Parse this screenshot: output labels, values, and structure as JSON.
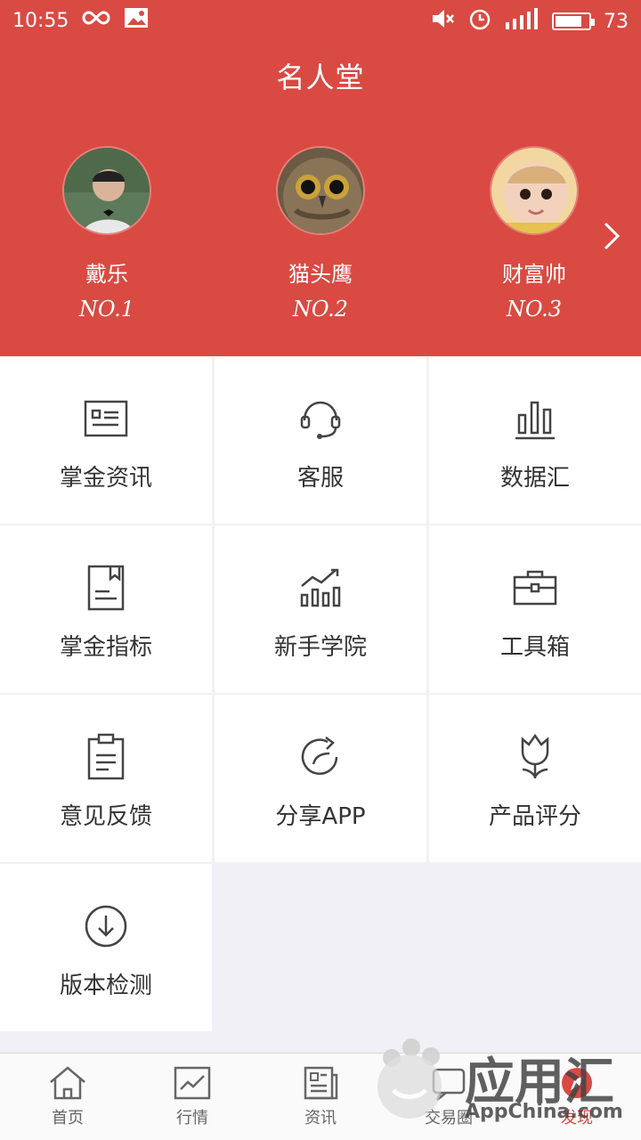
{
  "status_bar": {
    "time": "10:55",
    "network": "4G",
    "battery": "73"
  },
  "header": {
    "title": "名人堂"
  },
  "hall_of_fame": [
    {
      "name": "戴乐",
      "rank": "NO.1"
    },
    {
      "name": "猫头鹰",
      "rank": "NO.2"
    },
    {
      "name": "财富帅",
      "rank": "NO.3"
    }
  ],
  "menu": [
    {
      "label": "掌金资讯",
      "icon": "news-icon"
    },
    {
      "label": "客服",
      "icon": "headset-icon"
    },
    {
      "label": "数据汇",
      "icon": "bar-chart-icon"
    },
    {
      "label": "掌金指标",
      "icon": "document-icon"
    },
    {
      "label": "新手学院",
      "icon": "growth-chart-icon"
    },
    {
      "label": "工具箱",
      "icon": "toolbox-icon"
    },
    {
      "label": "意见反馈",
      "icon": "clipboard-icon"
    },
    {
      "label": "分享APP",
      "icon": "share-refresh-icon"
    },
    {
      "label": "产品评分",
      "icon": "tulip-icon"
    },
    {
      "label": "版本检测",
      "icon": "download-circle-icon"
    }
  ],
  "tabbar": [
    {
      "label": "首页",
      "icon": "home-icon"
    },
    {
      "label": "行情",
      "icon": "trend-icon"
    },
    {
      "label": "资讯",
      "icon": "newspaper-icon"
    },
    {
      "label": "交易圈",
      "icon": "chat-icon"
    },
    {
      "label": "发现",
      "icon": "compass-icon",
      "active": true
    }
  ],
  "watermark": {
    "title": "应用汇",
    "subtitle": "AppChina.com"
  },
  "colors": {
    "brand": "#d94a43",
    "text": "#333333",
    "icon": "#444444"
  }
}
